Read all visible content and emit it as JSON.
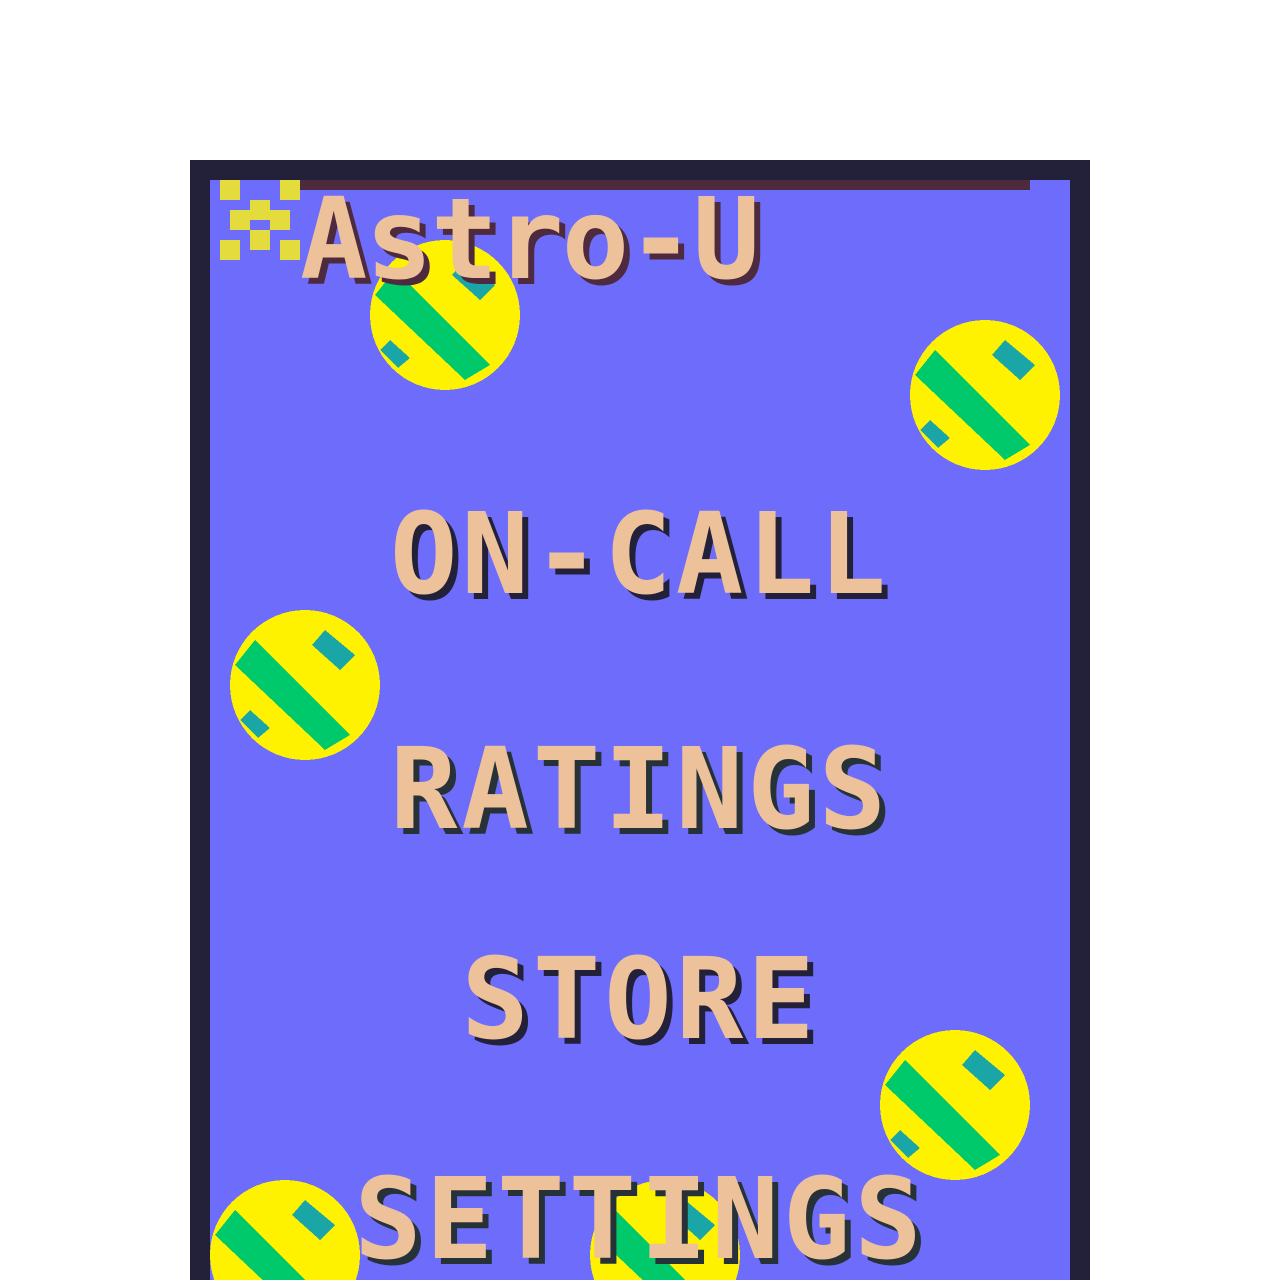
{
  "game": {
    "title": "Astro-U"
  },
  "menu": {
    "items": [
      {
        "label": "ON-CALL"
      },
      {
        "label": "RATINGS"
      },
      {
        "label": "STORE"
      },
      {
        "label": "SETTINGS"
      }
    ]
  },
  "colors": {
    "background": "#6d6cfb",
    "frame": "#23213a",
    "text": "#edc199",
    "ball_yellow": "#fff200",
    "ball_green": "#00c96b",
    "ball_teal": "#1aa6a6"
  },
  "icons": [
    "sparkle-icon",
    "tennis-ball-icon"
  ]
}
